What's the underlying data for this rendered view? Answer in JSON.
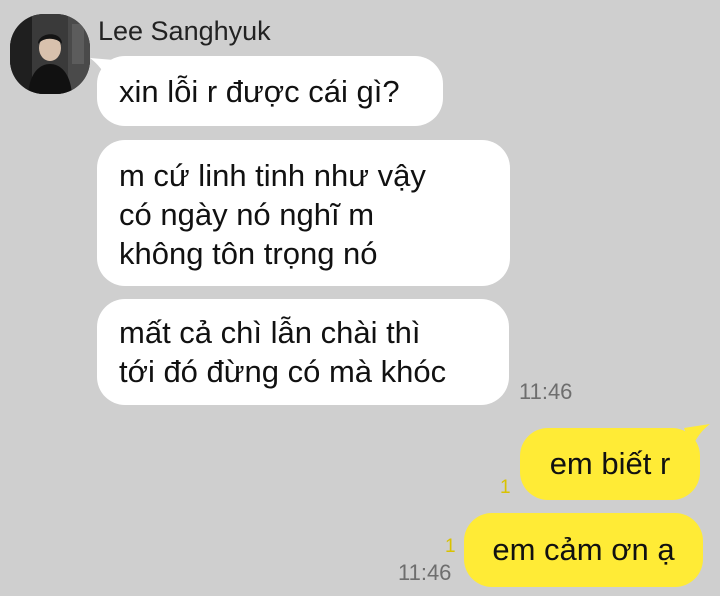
{
  "chat": {
    "sender": "Lee Sanghyuk",
    "incoming": [
      {
        "lines": [
          "xin lỗi r được cái gì?"
        ]
      },
      {
        "lines": [
          "m cứ linh tinh như vậy",
          "có ngày nó nghĩ m",
          "không tôn trọng nó"
        ]
      },
      {
        "lines": [
          "mất cả chì lẫn chài thì",
          "tới đó đừng có mà khóc"
        ]
      }
    ],
    "incoming_time": "11:46",
    "outgoing": [
      {
        "text": "em biết r",
        "unread": "1"
      },
      {
        "text": "em cảm ơn ạ",
        "unread": "1"
      }
    ],
    "outgoing_time": "11:46"
  },
  "colors": {
    "background": "#cfcfcf",
    "incoming_bubble": "#ffffff",
    "outgoing_bubble": "#ffeb36",
    "unread_count": "#d9c200"
  },
  "icons": {
    "avatar": "profile-photo"
  }
}
